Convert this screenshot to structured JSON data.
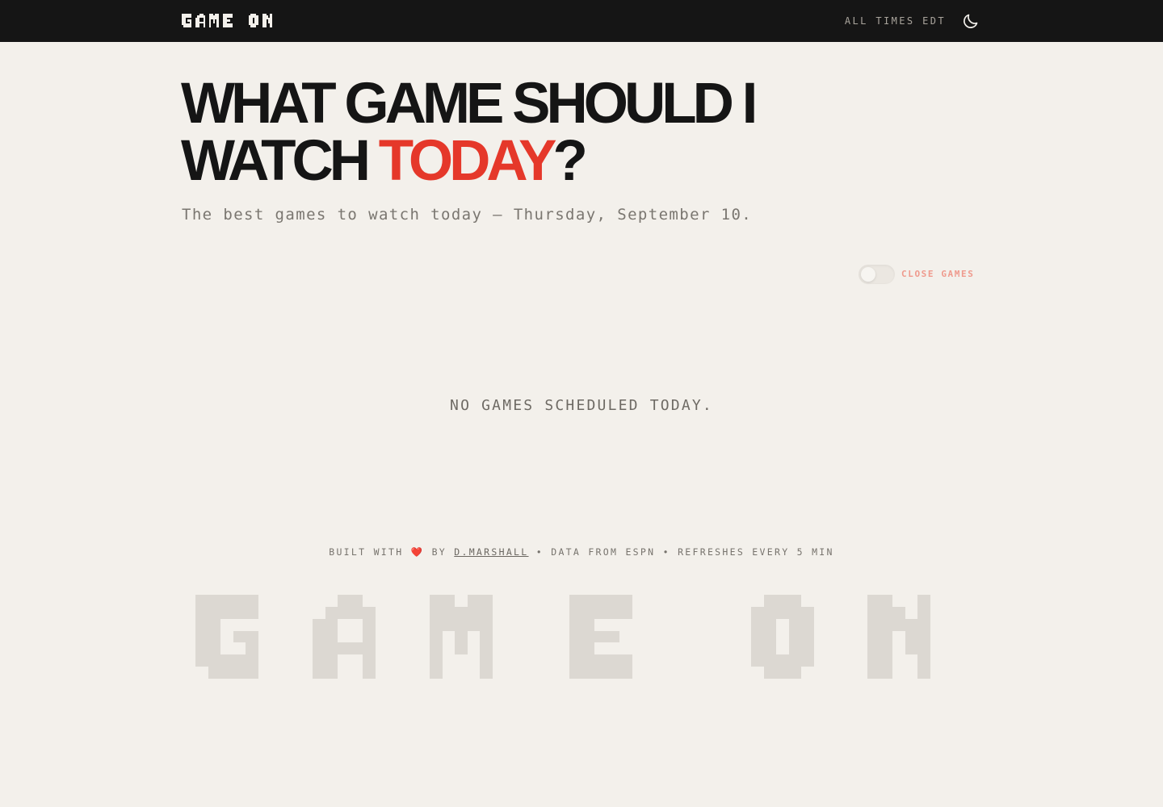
{
  "nav": {
    "brand": "GAME ON",
    "timezone_label": "ALL TIMES EDT",
    "theme_toggle_icon": "moon-icon"
  },
  "hero": {
    "title_line1": "WHAT GAME SHOULD I",
    "title_line2_before": "WATCH ",
    "title_accent": "TODAY",
    "title_after": "?",
    "subtitle": "The best games to watch today – Thursday, September 10."
  },
  "filters": {
    "close_games_label": "CLOSE GAMES",
    "close_games_enabled": false
  },
  "empty_state": {
    "message": "NO GAMES SCHEDULED TODAY."
  },
  "footer": {
    "built_with": "BUILT WITH",
    "heart": "❤️",
    "by": "BY",
    "author": "D.MARSHALL",
    "separator": "•",
    "data_source": "DATA FROM ESPN",
    "refresh_note": "REFRESHES EVERY 5 MIN"
  },
  "watermark": {
    "text": "GAME ON"
  },
  "colors": {
    "background": "#f3f0eb",
    "nav_background": "#151515",
    "accent": "#e5382a",
    "toggle_label": "#ef9a8d",
    "watermark": "#dcd8d2"
  }
}
